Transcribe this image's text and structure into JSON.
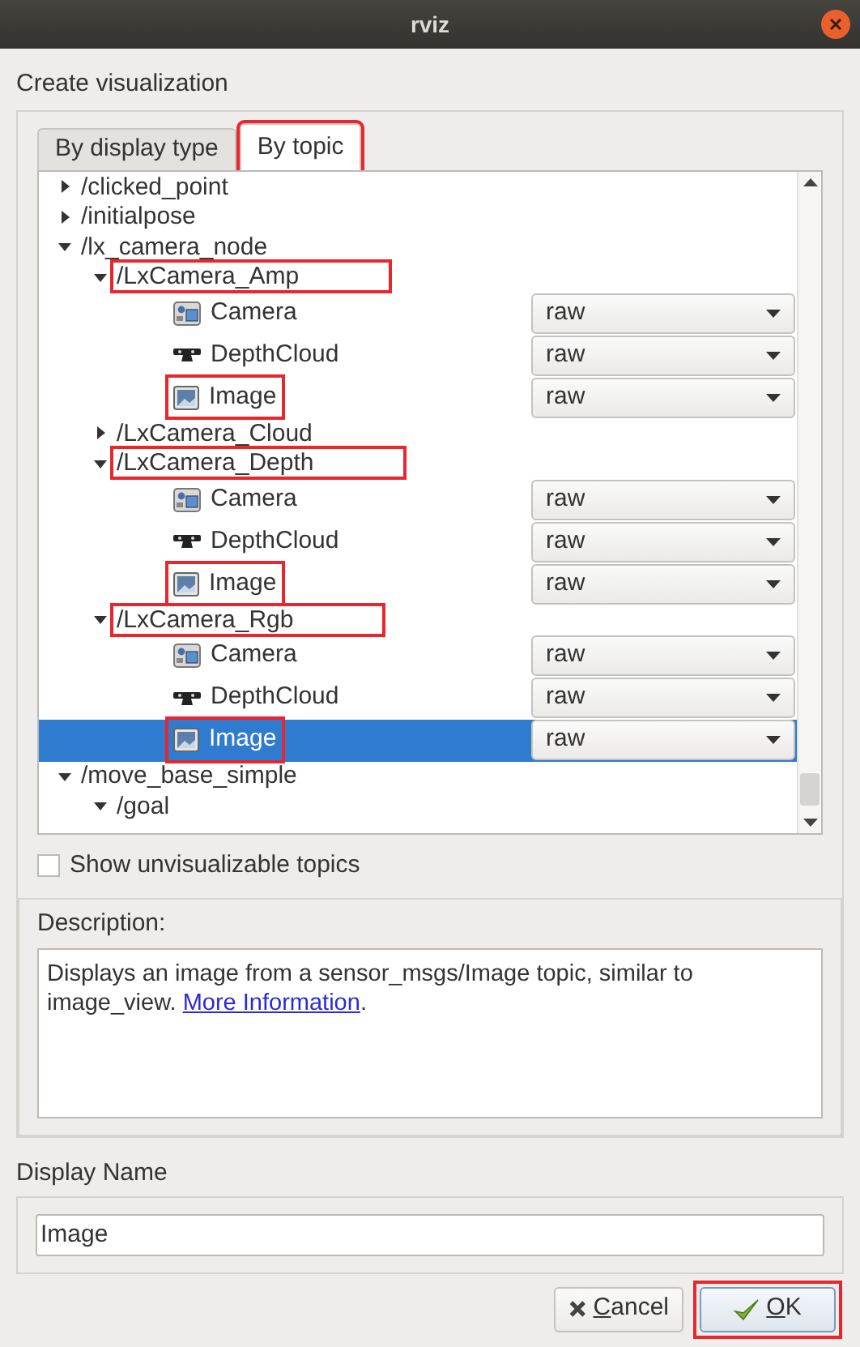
{
  "window": {
    "title": "rviz"
  },
  "heading": "Create visualization",
  "tabs": [
    {
      "label": "By display type",
      "selected": false,
      "highlighted": false
    },
    {
      "label": "By topic",
      "selected": true,
      "highlighted": true
    }
  ],
  "tree": [
    {
      "kind": "topic",
      "label": "/clicked_point",
      "expanded": false,
      "highlighted": false
    },
    {
      "kind": "topic",
      "label": "/initialpose",
      "expanded": false,
      "highlighted": false
    },
    {
      "kind": "topic",
      "label": "/lx_camera_node",
      "expanded": true,
      "highlighted": false,
      "children": [
        {
          "kind": "topic",
          "label": "/LxCamera_Amp",
          "expanded": true,
          "highlighted": true,
          "children": [
            {
              "kind": "camera",
              "label": "Camera",
              "value": "raw",
              "selected": false,
              "highlighted": false
            },
            {
              "kind": "depthcloud",
              "label": "DepthCloud",
              "value": "raw",
              "selected": false,
              "highlighted": false
            },
            {
              "kind": "image",
              "label": "Image",
              "value": "raw",
              "selected": false,
              "highlighted": true
            }
          ]
        },
        {
          "kind": "topic",
          "label": "/LxCamera_Cloud",
          "expanded": false,
          "highlighted": false
        },
        {
          "kind": "topic",
          "label": "/LxCamera_Depth",
          "expanded": true,
          "highlighted": true,
          "children": [
            {
              "kind": "camera",
              "label": "Camera",
              "value": "raw",
              "selected": false,
              "highlighted": false
            },
            {
              "kind": "depthcloud",
              "label": "DepthCloud",
              "value": "raw",
              "selected": false,
              "highlighted": false
            },
            {
              "kind": "image",
              "label": "Image",
              "value": "raw",
              "selected": false,
              "highlighted": true
            }
          ]
        },
        {
          "kind": "topic",
          "label": "/LxCamera_Rgb",
          "expanded": true,
          "highlighted": true,
          "children": [
            {
              "kind": "camera",
              "label": "Camera",
              "value": "raw",
              "selected": false,
              "highlighted": false
            },
            {
              "kind": "depthcloud",
              "label": "DepthCloud",
              "value": "raw",
              "selected": false,
              "highlighted": false
            },
            {
              "kind": "image",
              "label": "Image",
              "value": "raw",
              "selected": true,
              "highlighted": true
            }
          ]
        }
      ]
    },
    {
      "kind": "topic",
      "label": "/move_base_simple",
      "expanded": true,
      "highlighted": false,
      "children": [
        {
          "kind": "topic",
          "label": "/goal",
          "expanded": true,
          "highlighted": false
        }
      ]
    }
  ],
  "show_unvisualizable": {
    "label": "Show unvisualizable topics",
    "checked": false
  },
  "description": {
    "label": "Description:",
    "text": "Displays an image from a sensor_msgs/Image topic, similar to image_view.",
    "link": "More Information",
    "after_link": "."
  },
  "display_name": {
    "label": "Display Name",
    "value": "Image"
  },
  "buttons": [
    {
      "kind": "cancel",
      "label": "Cancel",
      "highlighted": false
    },
    {
      "kind": "ok",
      "label": "OK",
      "highlighted": true
    }
  ]
}
